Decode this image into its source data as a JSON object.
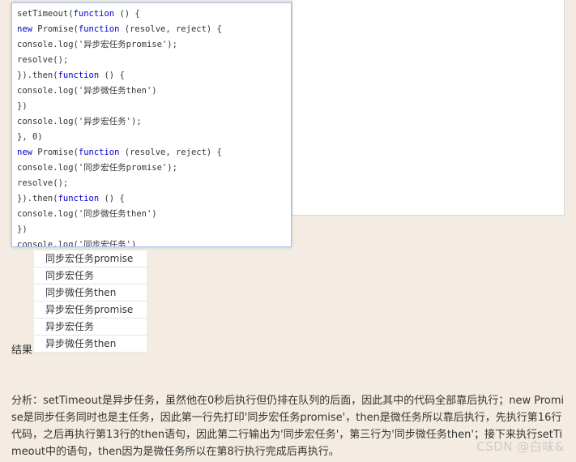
{
  "code_lines": [
    [
      {
        "t": "setTimeout(",
        "k": false
      },
      {
        "t": "function",
        "k": true
      },
      {
        "t": " () {",
        "k": false
      }
    ],
    [
      {
        "t": "new",
        "k": true
      },
      {
        "t": " Promise(",
        "k": false
      },
      {
        "t": "function",
        "k": true
      },
      {
        "t": " (resolve, reject) {",
        "k": false
      }
    ],
    [
      {
        "t": "console.log('异步宏任务promise');",
        "k": false
      }
    ],
    [
      {
        "t": "resolve();",
        "k": false
      }
    ],
    [
      {
        "t": "}).then(",
        "k": false
      },
      {
        "t": "function",
        "k": true
      },
      {
        "t": " () {",
        "k": false
      }
    ],
    [
      {
        "t": "console.log('异步微任务then')",
        "k": false
      }
    ],
    [
      {
        "t": "})",
        "k": false
      }
    ],
    [
      {
        "t": "console.log('异步宏任务');",
        "k": false
      }
    ],
    [
      {
        "t": "}, 0)",
        "k": false
      }
    ],
    [
      {
        "t": "new",
        "k": true
      },
      {
        "t": " Promise(",
        "k": false
      },
      {
        "t": "function",
        "k": true
      },
      {
        "t": " (resolve, reject) {",
        "k": false
      }
    ],
    [
      {
        "t": "console.log('同步宏任务promise');",
        "k": false
      }
    ],
    [
      {
        "t": "resolve();",
        "k": false
      }
    ],
    [
      {
        "t": "}).then(",
        "k": false
      },
      {
        "t": "function",
        "k": true
      },
      {
        "t": " () {",
        "k": false
      }
    ],
    [
      {
        "t": "console.log('同步微任务then')",
        "k": false
      }
    ],
    [
      {
        "t": "})",
        "k": false
      }
    ],
    [
      {
        "t": "console.log('同步宏任务')",
        "k": false
      }
    ]
  ],
  "results": {
    "label": "结果",
    "items": [
      "同步宏任务promise",
      "同步宏任务",
      "同步微任务then",
      "异步宏任务promise",
      "异步宏任务",
      "异步微任务then"
    ]
  },
  "analysis": {
    "text": "分析：setTimeout是异步任务，虽然他在0秒后执行但仍排在队列的后面，因此其中的代码全部靠后执行；new Promise是同步任务同时也是主任务，因此第一行先打印'同步宏任务promise'，then是微任务所以靠后执行，先执行第16行代码，之后再执行第13行的then语句，因此第二行输出为'同步宏任务'，第三行为'同步微任务then'；接下来执行setTimeout中的语句，then因为是微任务所以在第8行执行完成后再执行。"
  },
  "watermark": "CSDN @白味&",
  "colors": {
    "page_background": "#f4ece2",
    "keyword": "#0000cc",
    "code_box_border": "#9ec6ef"
  }
}
